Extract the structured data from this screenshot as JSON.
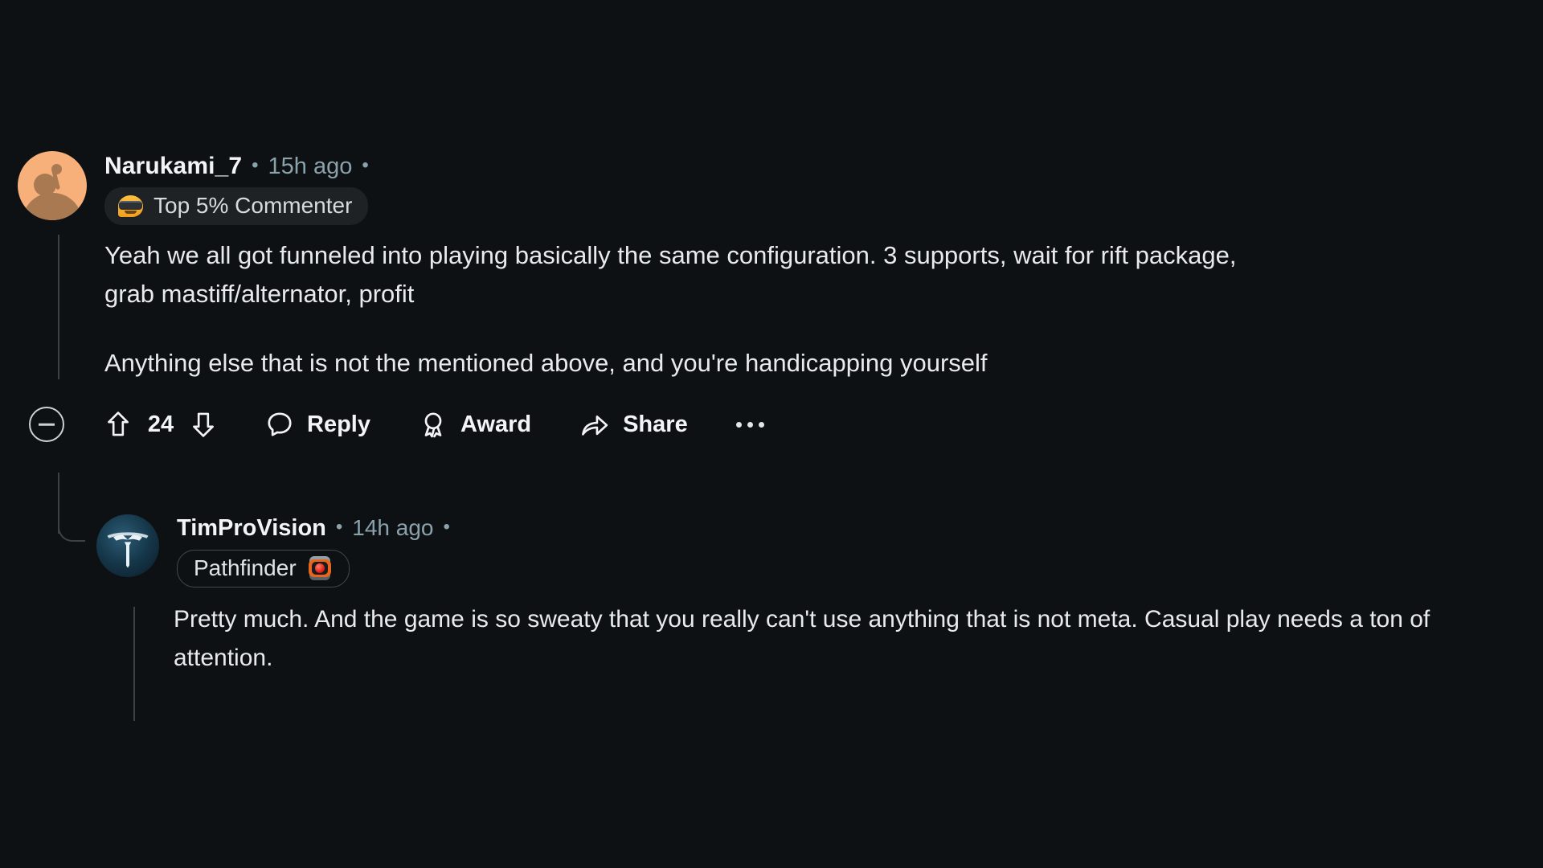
{
  "theme": {
    "background": "#0E1113",
    "text_primary": "#E8EAEC",
    "text_muted": "#8BA2AD",
    "thread_line": "#3D4144",
    "badge_fill": "#1F2224"
  },
  "comment": {
    "author": "Narukami_7",
    "separator_dot": "•",
    "timestamp": "15h ago",
    "trailing_dot": "•",
    "avatar": "reddit-snoo-avatar",
    "flair": {
      "label": "Top 5% Commenter",
      "emoji": "sunglasses-face-emoji",
      "style": "filled"
    },
    "paragraphs": [
      "Yeah we all got funneled into playing basically the same configuration. 3 supports, wait for rift package, grab mastiff/alternator, profit",
      "Anything else that is not the mentioned above, and you're handicapping yourself"
    ],
    "actions": {
      "collapse": "collapse-thread",
      "upvote": "upvote",
      "vote_count": "24",
      "downvote": "downvote",
      "reply_label": "Reply",
      "award_label": "Award",
      "share_label": "Share",
      "overflow_label": "More options"
    }
  },
  "reply": {
    "author": "TimProVision",
    "separator_dot": "•",
    "timestamp": "14h ago",
    "trailing_dot": "•",
    "avatar": "tesla-emblem-avatar",
    "flair": {
      "label": "Pathfinder",
      "emoji": "pathfinder-robot-eye-emoji",
      "style": "outlined"
    },
    "paragraphs": [
      "Pretty much. And the game is so sweaty that you really can't use anything that is not meta. Casual play needs a ton of attention."
    ]
  }
}
